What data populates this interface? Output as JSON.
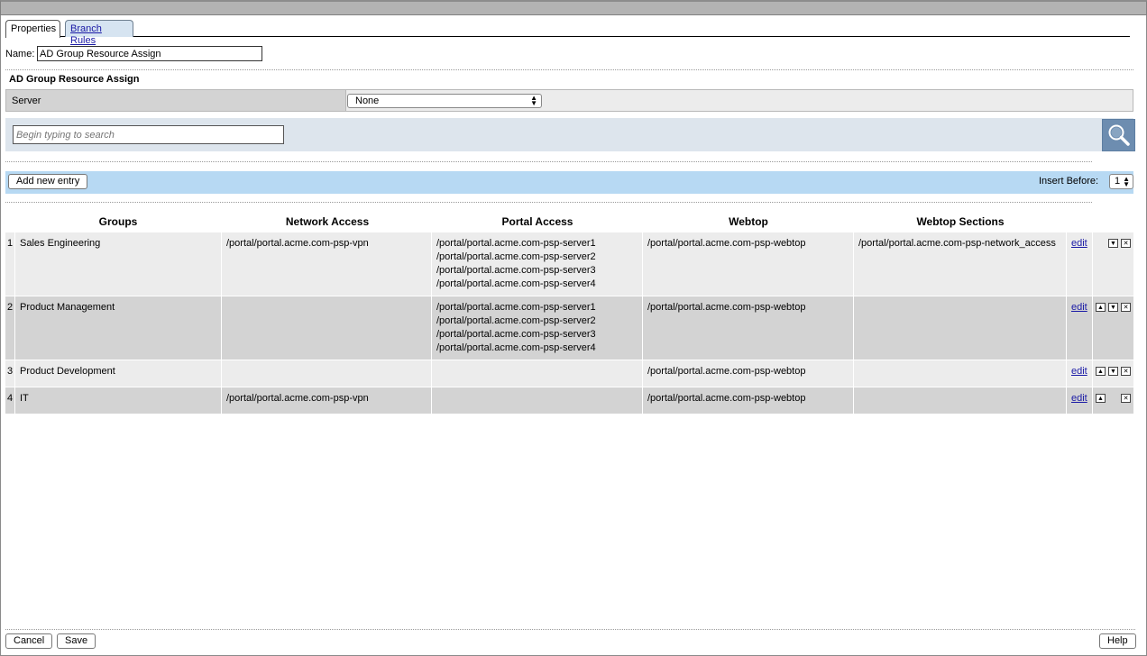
{
  "tabs": {
    "properties": "Properties",
    "branch_rules": "Branch Rules"
  },
  "name_field": {
    "label": "Name:",
    "value": "AD Group Resource Assign"
  },
  "section": {
    "title": "AD Group Resource Assign"
  },
  "server": {
    "label": "Server",
    "selected": "None"
  },
  "search": {
    "placeholder": "Begin typing to search"
  },
  "toolbar": {
    "add_label": "Add new entry",
    "insert_before_label": "Insert Before:",
    "insert_before_value": "1"
  },
  "table": {
    "columns": [
      "Groups",
      "Network Access",
      "Portal Access",
      "Webtop",
      "Webtop Sections"
    ],
    "edit_label": "edit",
    "rows": [
      {
        "index": "1",
        "group": "Sales Engineering",
        "network_access": "/portal/portal.acme.com-psp-vpn",
        "portal_access": [
          "/portal/portal.acme.com-psp-server1",
          "/portal/portal.acme.com-psp-server2",
          "/portal/portal.acme.com-psp-server3",
          "/portal/portal.acme.com-psp-server4"
        ],
        "webtop": "/portal/portal.acme.com-psp-webtop",
        "webtop_sections": "/portal/portal.acme.com-psp-network_access"
      },
      {
        "index": "2",
        "group": "Product Management",
        "network_access": "",
        "portal_access": [
          "/portal/portal.acme.com-psp-server1",
          "/portal/portal.acme.com-psp-server2",
          "/portal/portal.acme.com-psp-server3",
          "/portal/portal.acme.com-psp-server4"
        ],
        "webtop": "/portal/portal.acme.com-psp-webtop",
        "webtop_sections": ""
      },
      {
        "index": "3",
        "group": "Product Development",
        "network_access": "",
        "portal_access": [],
        "webtop": "/portal/portal.acme.com-psp-webtop",
        "webtop_sections": ""
      },
      {
        "index": "4",
        "group": "IT",
        "network_access": "/portal/portal.acme.com-psp-vpn",
        "portal_access": [],
        "webtop": "/portal/portal.acme.com-psp-webtop",
        "webtop_sections": ""
      }
    ]
  },
  "icons": {
    "search": "magnifier-icon",
    "move_up": "arrow-up-icon",
    "move_down": "arrow-down-icon",
    "delete": "close-icon"
  },
  "footer": {
    "cancel_label": "Cancel",
    "save_label": "Save",
    "help_label": "Help"
  },
  "colors": {
    "toolbar": "#b7d9f3",
    "search_bar": "#dde5ed",
    "search_button": "#6d8db0",
    "row_light": "#ececec",
    "row_dark": "#d3d3d3"
  }
}
